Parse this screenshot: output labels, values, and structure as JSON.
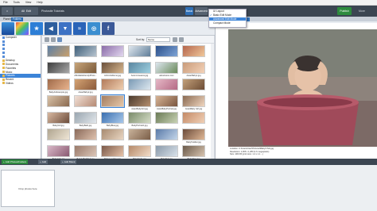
{
  "menu": [
    "File",
    "Tools",
    "View",
    "Help"
  ],
  "toolbar": {
    "home": "⌂",
    "all": "All",
    "all_sub": "Edit",
    "label": "Photosite Tutorials",
    "mode_btn": "Basic",
    "adv_btn": "Advanced",
    "publish": "Publish",
    "more": "More"
  },
  "mode_menu": {
    "items": [
      {
        "label": "UI Layout",
        "checked": false,
        "highlight": false
      },
      {
        "label": "Basic Edit Mode",
        "checked": true,
        "highlight": false
      },
      {
        "label": "Advanced Edit Mode",
        "checked": false,
        "highlight": true
      },
      {
        "label": "Compact Mode",
        "checked": false,
        "highlight": false
      }
    ]
  },
  "tabs": [
    "Planning",
    "Folders"
  ],
  "tiles": [
    {
      "name": "gradient-tile",
      "color": "#4a6fb5",
      "glyph": ""
    },
    {
      "name": "rainbow-tile",
      "color": "#c94f8f",
      "glyph": ""
    },
    {
      "name": "star-tile",
      "color": "#2d7ed6",
      "glyph": "★"
    },
    {
      "name": "arrows-tile",
      "color": "#2d5e9e",
      "glyph": "◀"
    },
    {
      "name": "arrow-down-tile",
      "color": "#3d72c4",
      "glyph": "▼"
    },
    {
      "name": "fish-tile",
      "color": "#2a64b8",
      "glyph": "≈"
    },
    {
      "name": "globe-tile",
      "color": "#3b8ed0",
      "glyph": "◎"
    },
    {
      "name": "facebook-tile",
      "color": "#3b5998",
      "glyph": "f"
    }
  ],
  "tree": [
    {
      "label": "Computer",
      "color": "#5a8fd8",
      "selected": false
    },
    {
      "label": "",
      "color": "#5a8fd8",
      "selected": false
    },
    {
      "label": "",
      "color": "#5a8fd8",
      "selected": false
    },
    {
      "label": "",
      "color": "#5a8fd8",
      "selected": false
    },
    {
      "label": "",
      "color": "#5a8fd8",
      "selected": false
    },
    {
      "label": "",
      "color": "#5a8fd8",
      "selected": false
    },
    {
      "label": "Desktop",
      "color": "#e6b84a",
      "selected": false
    },
    {
      "label": "Documents",
      "color": "#e6b84a",
      "selected": false
    },
    {
      "label": "Favorites",
      "color": "#e6b84a",
      "selected": false
    },
    {
      "label": "Music",
      "color": "#e6b84a",
      "selected": false
    },
    {
      "label": "Pictures",
      "color": "#e6b84a",
      "selected": true
    },
    {
      "label": "Recent",
      "color": "#e6b84a",
      "selected": false
    },
    {
      "label": "Videos",
      "color": "#e6b84a",
      "selected": false
    }
  ],
  "grid_toolbar": {
    "sort_label": "Sort by:",
    "sort_value": "Name"
  },
  "thumbnails": [
    {
      "caption": "",
      "c1": "#5b7fa6",
      "c2": "#c9a06c"
    },
    {
      "caption": "",
      "c1": "#3f5f7a",
      "c2": "#b7c4cf"
    },
    {
      "caption": "",
      "c1": "#8a6ba8",
      "c2": "#e2d7ef"
    },
    {
      "caption": "",
      "c1": "#dfe7ee",
      "c2": "#5f7d98"
    },
    {
      "caption": "",
      "c1": "#2a4f8a",
      "c2": "#7fa4d6"
    },
    {
      "caption": "",
      "c1": "#b5654c",
      "c2": "#f0c89b"
    },
    {
      "caption": "",
      "c1": "#3d3d3d",
      "c2": "#a9a9a9"
    },
    {
      "caption": "AffordableFamilyPhoto...",
      "c1": "#c8a57a",
      "c2": "#7a5a3a"
    },
    {
      "caption": "ArtCircleDemo.jpg",
      "c1": "#6a4f3a",
      "c2": "#d8b890"
    },
    {
      "caption": "AutumnLeaves.jpg",
      "c1": "#5a86a0",
      "c2": "#9ed0e0"
    },
    {
      "caption": "advantures.com",
      "c1": "#dce6ee",
      "c2": "#6b8a5a"
    },
    {
      "caption": "AsianBaby1.jpg",
      "c1": "#c99b7a",
      "c2": "#f3d2b8"
    },
    {
      "caption": "BabyArtExample.jpg",
      "c1": "#a06b4a",
      "c2": "#e8b38d"
    },
    {
      "caption": "AsianBaby2.jpg",
      "c1": "#d4a374",
      "c2": "#8b5a3a"
    },
    {
      "caption": "",
      "c1": "#b27a5a",
      "c2": "#efcfb0"
    },
    {
      "caption": "",
      "c1": "#7a9ab5",
      "c2": "#dde7ef"
    },
    {
      "caption": "",
      "c1": "#e5b8c6",
      "c2": "#b56a85"
    },
    {
      "caption": "",
      "c1": "#c2a07a",
      "c2": "#6d4c34"
    },
    {
      "caption": "",
      "c1": "#d9c2a8",
      "c2": "#8a6a50"
    },
    {
      "caption": "",
      "c1": "#f1e0d6",
      "c2": "#b58a74"
    },
    {
      "caption": "",
      "c1": "#a47e62",
      "c2": "#e6c7a8"
    },
    {
      "caption": "AsianBabyGirl.jpg",
      "c1": "#4a3a2e",
      "c2": "#b58f6e"
    },
    {
      "caption": "AsianBabyPortrait.jpg",
      "c1": "#d7b495",
      "c2": "#7a5640"
    },
    {
      "caption": "AsianBaby Girl.jpg",
      "c1": "#8a6a52",
      "c2": "#f0d6bf"
    },
    {
      "caption": "BabyGirl.jpg",
      "c1": "#d8b8a0",
      "c2": "#6c4d3c"
    },
    {
      "caption": "BabyBath.jpg",
      "c1": "#9aa6b0",
      "c2": "#e2e7eb"
    },
    {
      "caption": "BabyBlue.jpg",
      "c1": "#3a6fb0",
      "c2": "#a8c8ea"
    },
    {
      "caption": "BabyPortrait1.jpg",
      "c1": "#7a8b6a",
      "c2": "#d4dcc6"
    },
    {
      "caption": "",
      "c1": "#6a7a56",
      "c2": "#c9d3b4"
    },
    {
      "caption": "",
      "c1": "#c48a66",
      "c2": "#f0d0b6"
    },
    {
      "caption": "",
      "c1": "#b0a590",
      "c2": "#efe6d6"
    },
    {
      "caption": "",
      "c1": "#8a6a5a",
      "c2": "#dfc2ae"
    },
    {
      "caption": "",
      "c1": "#a78a70",
      "c2": "#e9d6c2"
    },
    {
      "caption": "",
      "c1": "#c9b29a",
      "c2": "#7a5e48"
    },
    {
      "caption": "",
      "c1": "#5a7aa8",
      "c2": "#c4d6ea"
    },
    {
      "caption": "BabyToddler.jpg",
      "c1": "#6b4b3a",
      "c2": "#e0b896"
    },
    {
      "caption": "BabyGirls.jpg",
      "c1": "#d9b8c8",
      "c2": "#8a5a72"
    },
    {
      "caption": "BabyInBathTub.jpg",
      "c1": "#9a7a6a",
      "c2": "#dcc6b8"
    },
    {
      "caption": "BabyLaughing.jpg",
      "c1": "#7a5848",
      "c2": "#e8c4aa"
    },
    {
      "caption": "BabySmile.jpg",
      "c1": "#b58a6a",
      "c2": "#f3dcc8"
    },
    {
      "caption": "BabyTub.jpg",
      "c1": "#8a9aaa",
      "c2": "#d9e2ea"
    },
    {
      "caption": "BabyMom.jpg",
      "c1": "#6a5a4a",
      "c2": "#d8c4b0"
    },
    {
      "caption": "",
      "c1": "#3a5a8a",
      "c2": "#9ab8da"
    },
    {
      "caption": "",
      "c1": "#8a6a4a",
      "c2": "#e0c09a"
    },
    {
      "caption": "",
      "c1": "#4a7a9a",
      "c2": "#b8d8ea"
    },
    {
      "caption": "",
      "c1": "#c9a080",
      "c2": "#6a4a34"
    },
    {
      "caption": "",
      "c1": "#9a8a7a",
      "c2": "#e6dacd"
    },
    {
      "caption": "",
      "c1": "#7a6a5a",
      "c2": "#d8c8b8"
    },
    {
      "caption": "",
      "c1": "#5a6a7a",
      "c2": "#c6d0da"
    }
  ],
  "selected_thumb": 20,
  "preview": {
    "filename": "BabyInTub.jpg",
    "info_location": "Location:  C:\\Users\\User\\Pictures\\BabyInTub.jpg",
    "info_resolution": "Resolution:  1,365 x 1,280 (1.6 megapixels)",
    "info_size": "Size:  406 KB (print size: 1.2 x 1.1 ...)"
  },
  "bottom_bar": {
    "add_photos": "Add Photos/Folders",
    "add": "Add",
    "add_blank": "Add Blank"
  },
  "drop_box": "Drop photos here"
}
